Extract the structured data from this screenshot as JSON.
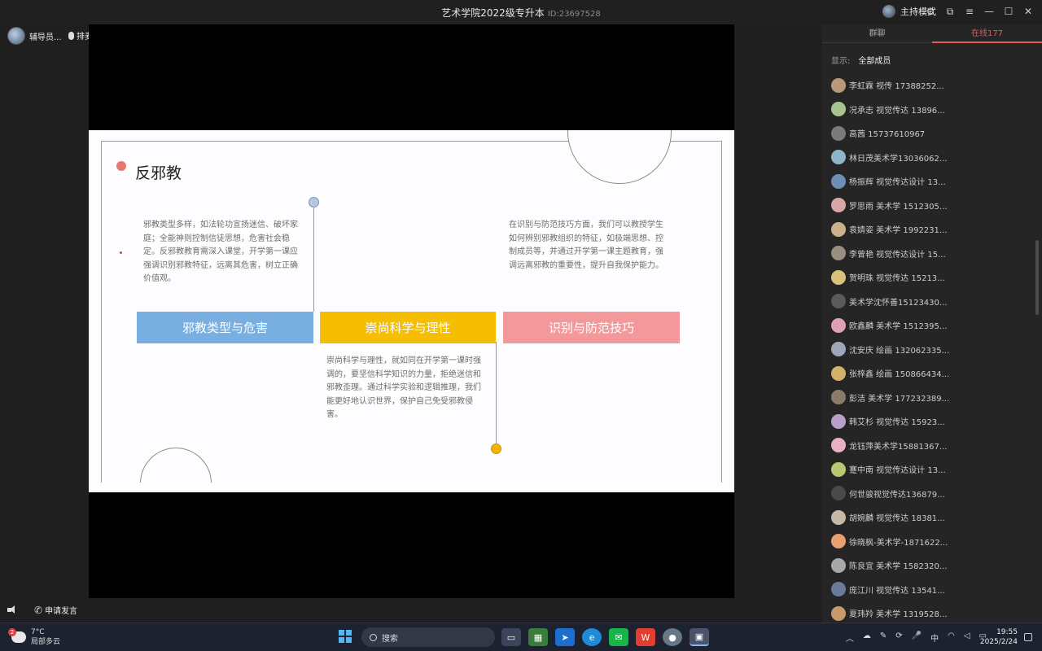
{
  "window": {
    "title": "艺术学院2022级专升本",
    "meeting_id": "ID:23697528",
    "host_mode_label": "主持模式",
    "controls": [
      "settings-icon",
      "popout-icon",
      "menu-icon",
      "minimize-icon",
      "maximize-icon",
      "close-icon"
    ]
  },
  "stage": {
    "advisor_name": "辅导员...",
    "queue_label": "排麦",
    "apply_speak_label": "申请发言"
  },
  "slide": {
    "title": "反邪教",
    "boxes": [
      "邪教类型与危害",
      "崇尚科学与理性",
      "识别与防范技巧"
    ],
    "box_colors": [
      "#78aee0",
      "#f6be02",
      "#f4999b"
    ],
    "para1": "邪教类型多样，如法轮功宣扬迷信、破坏家庭；全能神则控制信徒思想，危害社会稳定。反邪教教育需深入课堂，开学第一课应强调识别邪教特征，远离其危害，树立正确价值观。",
    "para2": "在识别与防范技巧方面，我们可以教授学生如何辨别邪教组织的特征，如极端思想、控制成员等，并通过开学第一课主题教育，强调远离邪教的重要性，提升自我保护能力。",
    "para3": "崇尚科学与理性，就如同在开学第一课时强调的，要坚信科学知识的力量，拒绝迷信和邪教歪理。通过科学实验和逻辑推理，我们能更好地认识世界，保护自己免受邪教侵害。"
  },
  "sidebar": {
    "tab_chat": "群聊",
    "tab_online": "在线177",
    "filter_label": "显示:",
    "filter_value": "全部成员",
    "members": [
      "李虹霖  视传  17388252...",
      "况承志 视觉传达 13896...",
      "高茜 15737610967",
      "林日茂美术学13036062...",
      "杨振辉 视觉传达设计 13...",
      "罗思雨 美术学 1512305...",
      "袁婧姿 美术学 1992231...",
      "李曾艳  视觉传达设计 15...",
      "贺明珠 视觉传达 15213...",
      "美术学沈怀善15123430...",
      "欧鑫麟 美术学 1512395...",
      "沈安庆 绘画 132062335...",
      "张梓鑫 绘画 150866434...",
      "彭洁 美术学 177232389...",
      "韩艾杉 视觉传达 15923...",
      "龙钰萍美术学15881367...",
      "蹇中南 视觉传达设计 13...",
      "何世骏视觉传达136879...",
      "胡婉麟 视觉传达 18381...",
      "徐晓枫-美术学-1871622...",
      "陈良宜 美术学 1582320...",
      "庞江川 视觉传达 13541...",
      "夏玮羚 美术学 1319528..."
    ],
    "avatar_colors": [
      "#b89a7a",
      "#a7c48f",
      "#7a7a7a",
      "#8fb3c9",
      "#6d8fb5",
      "#d9a6a6",
      "#c9b28a",
      "#9a8e7e",
      "#d8c27a",
      "#5a5a5a",
      "#e0a0b8",
      "#9aa8b8",
      "#d4b16a",
      "#8a7a6a",
      "#b8a0c8",
      "#e8b0c0",
      "#b8c870",
      "#4a4a4a",
      "#c8b8a8",
      "#e8a070",
      "#a8a8a8",
      "#6a7a9a",
      "#c89a6a"
    ]
  },
  "taskbar": {
    "weather_temp": "7°C",
    "weather_desc": "局部多云",
    "weather_badge": "2",
    "search_placeholder": "搜索",
    "apps": [
      "file-explorer-icon",
      "store-icon",
      "app-icon",
      "edge-icon",
      "wechat-icon",
      "wps-icon",
      "chrome-icon",
      "active-app-icon"
    ],
    "tray_ime": "中",
    "tray_ime2": "中",
    "time": "19:55",
    "date": "2025/2/24"
  }
}
